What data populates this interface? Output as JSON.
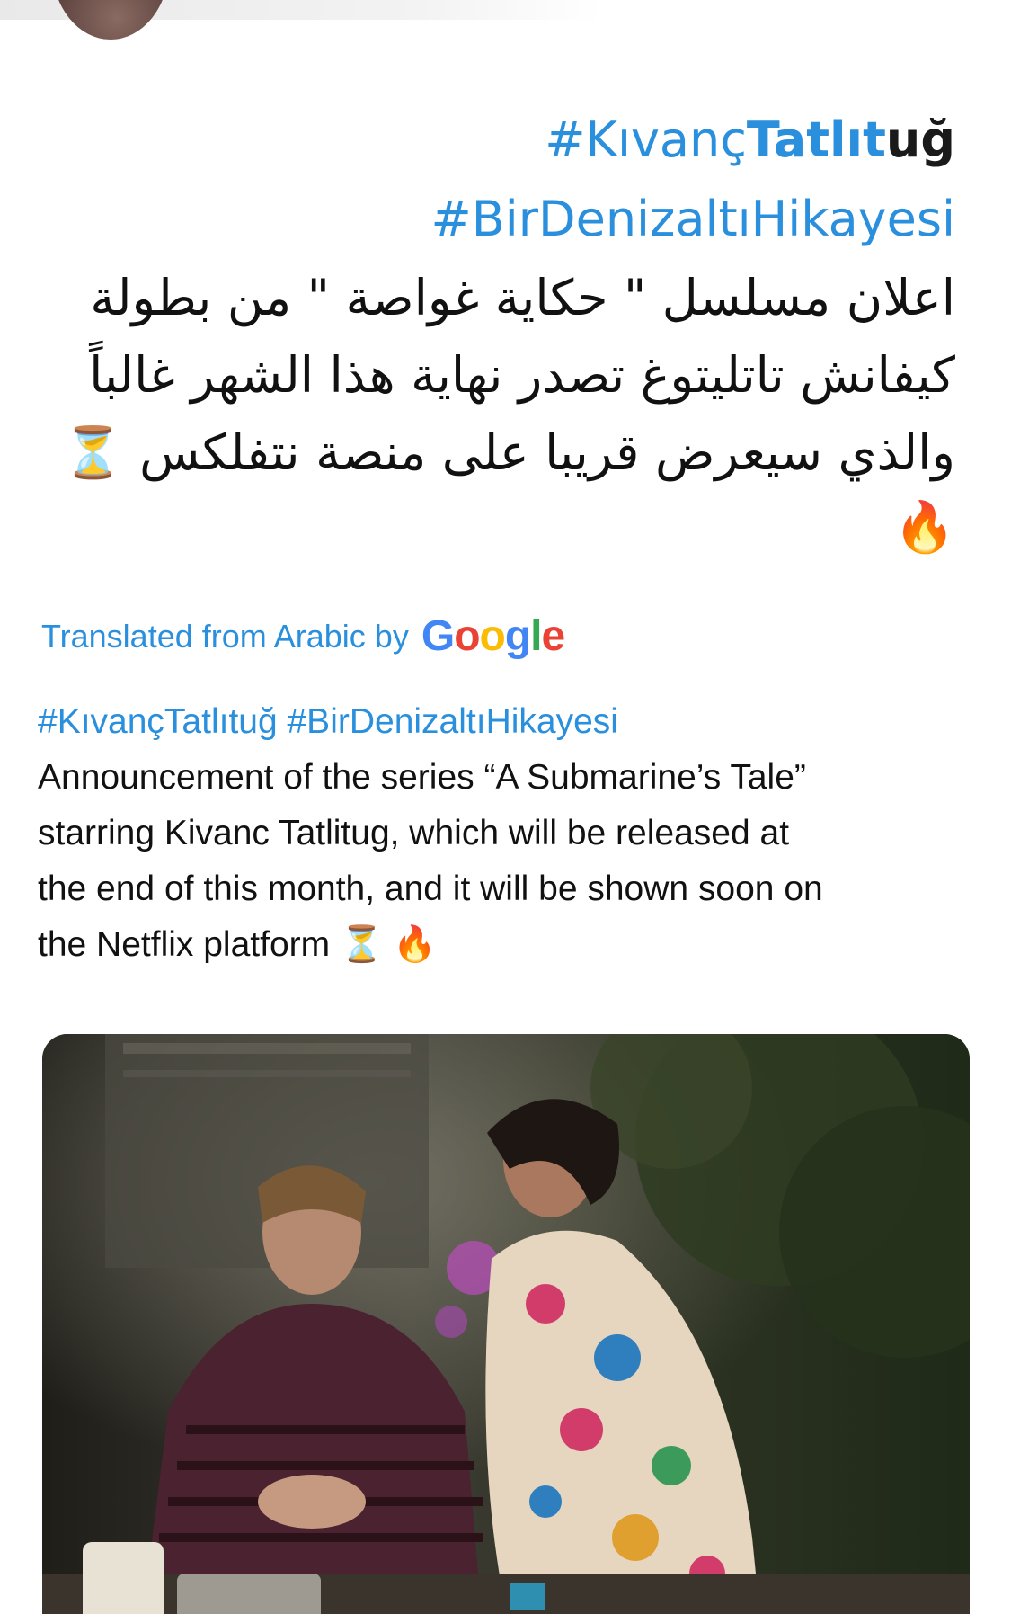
{
  "original_tweet": {
    "hashtag_1_blue": "#Kıvanç",
    "hashtag_1_bold": "Tatlıt",
    "hashtag_1_dark": "uğ",
    "hashtag_2": "#BirDenizaltıHikayesi",
    "arabic_lines": [
      "اعلان مسلسل \" حكاية غواصة \" من بطولة",
      "كيفانش تاتليتوغ تصدر نهاية هذا الشهر غالباً",
      "والذي سيعرض قريبا على منصة نتفلكس"
    ],
    "hourglass_emoji": "⏳",
    "fire_emoji": "🔥"
  },
  "translation_credit": {
    "label": "Translated from Arabic by",
    "provider_letters": [
      "G",
      "o",
      "o",
      "g",
      "l",
      "e"
    ]
  },
  "translation": {
    "hashtags": "#KıvançTatlıtuğ #BirDenizaltıHikayesi",
    "lines": [
      " Announcement of the series “A Submarine’s Tale”",
      "starring Kivanc Tatlitug, which will be released at",
      "the end of this month, and it will be shown soon on",
      "the Netflix platform"
    ],
    "hourglass_emoji": "⏳",
    "fire_emoji": "🔥"
  },
  "colors": {
    "link_blue": "#2a8fdc",
    "text": "#111111",
    "google_blue": "#4285f4",
    "google_red": "#ea4335",
    "google_yellow": "#fbbc05",
    "google_green": "#34a853"
  }
}
